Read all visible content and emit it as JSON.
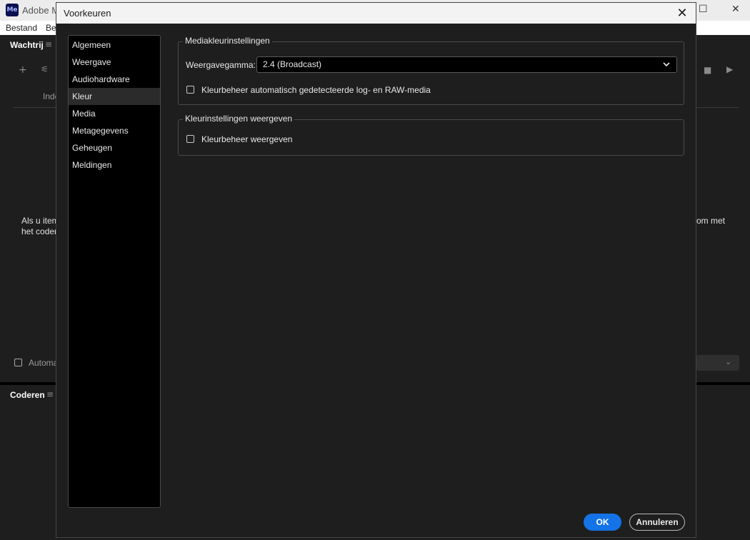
{
  "app": {
    "title": "Adobe M",
    "menu": [
      "Bestand",
      "Be"
    ],
    "queue_panel": {
      "title": "Wachtrij",
      "column_header": "Inde",
      "hint_left_line1": "Als u item",
      "hint_left_line2": "het codere",
      "hint_right": "om met",
      "auto_label": "Automa"
    },
    "encode_panel": {
      "title": "Coderen"
    }
  },
  "dialog": {
    "title": "Voorkeuren",
    "sidebar": {
      "selected": "Kleur",
      "items": [
        {
          "label": "Algemeen"
        },
        {
          "label": "Weergave"
        },
        {
          "label": "Audiohardware"
        },
        {
          "label": "Kleur"
        },
        {
          "label": "Media"
        },
        {
          "label": "Metagegevens"
        },
        {
          "label": "Geheugen"
        },
        {
          "label": "Meldingen"
        }
      ]
    },
    "media_color": {
      "legend": "Mediakleurinstellingen",
      "gamma_label": "Weergavegamma:",
      "gamma_value": "2.4 (Broadcast)",
      "auto_manage_label": "Kleurbeheer automatisch gedetecteerde log- en RAW-media",
      "auto_manage_checked": false
    },
    "display_color": {
      "legend": "Kleurinstellingen weergeven",
      "manage_label": "Kleurbeheer weergeven",
      "manage_checked": false
    },
    "buttons": {
      "ok": "OK",
      "cancel": "Annuleren"
    }
  }
}
